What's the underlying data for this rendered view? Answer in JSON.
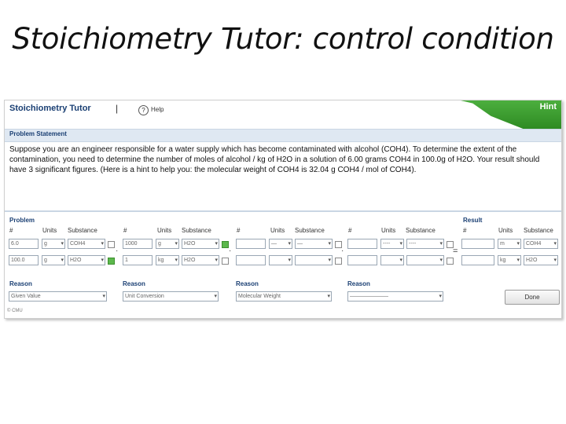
{
  "slide_title": "Stoichiometry Tutor: control condition",
  "app": {
    "name": "Stoichiometry Tutor",
    "separator": "|",
    "help_icon_glyph": "?",
    "help_label": "Help",
    "hint_label": "Hint",
    "hint_color": "#3a9b2e"
  },
  "statement": {
    "header": "Problem Statement",
    "text": "Suppose you are an engineer responsible for a water supply which has become contaminated with alcohol (COH4). To determine the extent of the contamination, you need to determine the number of moles of alcohol / kg of H2O in a solution of 6.00 grams COH4 in 100.0g of H2O. Your result should have 3 significant figures. (Here is a hint to help you: the molecular weight of COH4 is 32.04 g COH4 / mol of COH4)."
  },
  "problem": {
    "label": "Problem",
    "result_label": "Result",
    "columns": {
      "num": "#",
      "units": "Units",
      "substance": "Substance"
    },
    "terms": [
      {
        "top": {
          "num": "6.0",
          "units": "g",
          "substance": "COH4"
        },
        "bottom": {
          "num": "100.0",
          "units": "g",
          "substance": "H2O"
        },
        "reason": "Given Value",
        "operator": "·"
      },
      {
        "top": {
          "num": "1000",
          "units": "g",
          "substance": "H2O"
        },
        "bottom": {
          "num": "1",
          "units": "kg",
          "substance": "H2O"
        },
        "reason": "Unit Conversion",
        "operator": "·"
      },
      {
        "top": {
          "num": "",
          "units": "—",
          "substance": "—"
        },
        "bottom": {
          "num": "",
          "units": "",
          "substance": ""
        },
        "reason": "Molecular Weight",
        "operator": "·"
      },
      {
        "top": {
          "num": "",
          "units": "----",
          "substance": "----"
        },
        "bottom": {
          "num": "",
          "units": "",
          "substance": ""
        },
        "reason": "———————",
        "operator": "="
      }
    ],
    "result": {
      "top": {
        "num": "",
        "units": "m",
        "substance": "COH4"
      },
      "bottom": {
        "num": "",
        "units": "kg",
        "substance": "H2O"
      }
    },
    "reason_label": "Reason",
    "done_label": "Done"
  },
  "footer": "© CMU"
}
